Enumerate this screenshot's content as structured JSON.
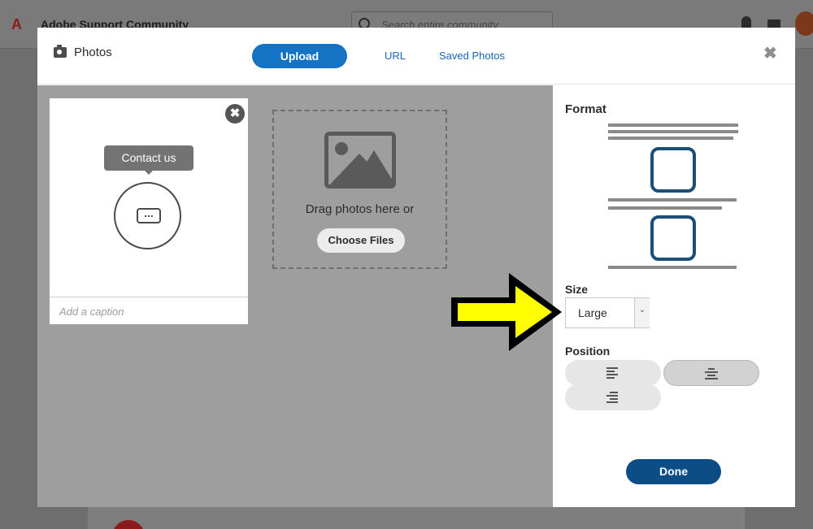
{
  "background": {
    "site_title": "Adobe Support Community",
    "search_placeholder": "Search entire community"
  },
  "modal": {
    "title": "Photos",
    "tabs": {
      "upload": "Upload",
      "url": "URL",
      "saved_photos": "Saved Photos"
    },
    "close_glyph": "✖"
  },
  "photo_card": {
    "tooltip": "Contact us",
    "caption_placeholder": "Add a caption",
    "remove_glyph": "✖"
  },
  "dropzone": {
    "text": "Drag photos here or",
    "button": "Choose Files"
  },
  "settings": {
    "format_label": "Format",
    "size_label": "Size",
    "size_value": "Large",
    "position_label": "Position",
    "positions": [
      "left",
      "center",
      "right"
    ],
    "selected_position": "center",
    "done_label": "Done"
  },
  "colors": {
    "accent": "#1473c5",
    "done": "#0d4d86",
    "overlay": "#9e9e9e",
    "arrow_fill": "#ffff00"
  }
}
